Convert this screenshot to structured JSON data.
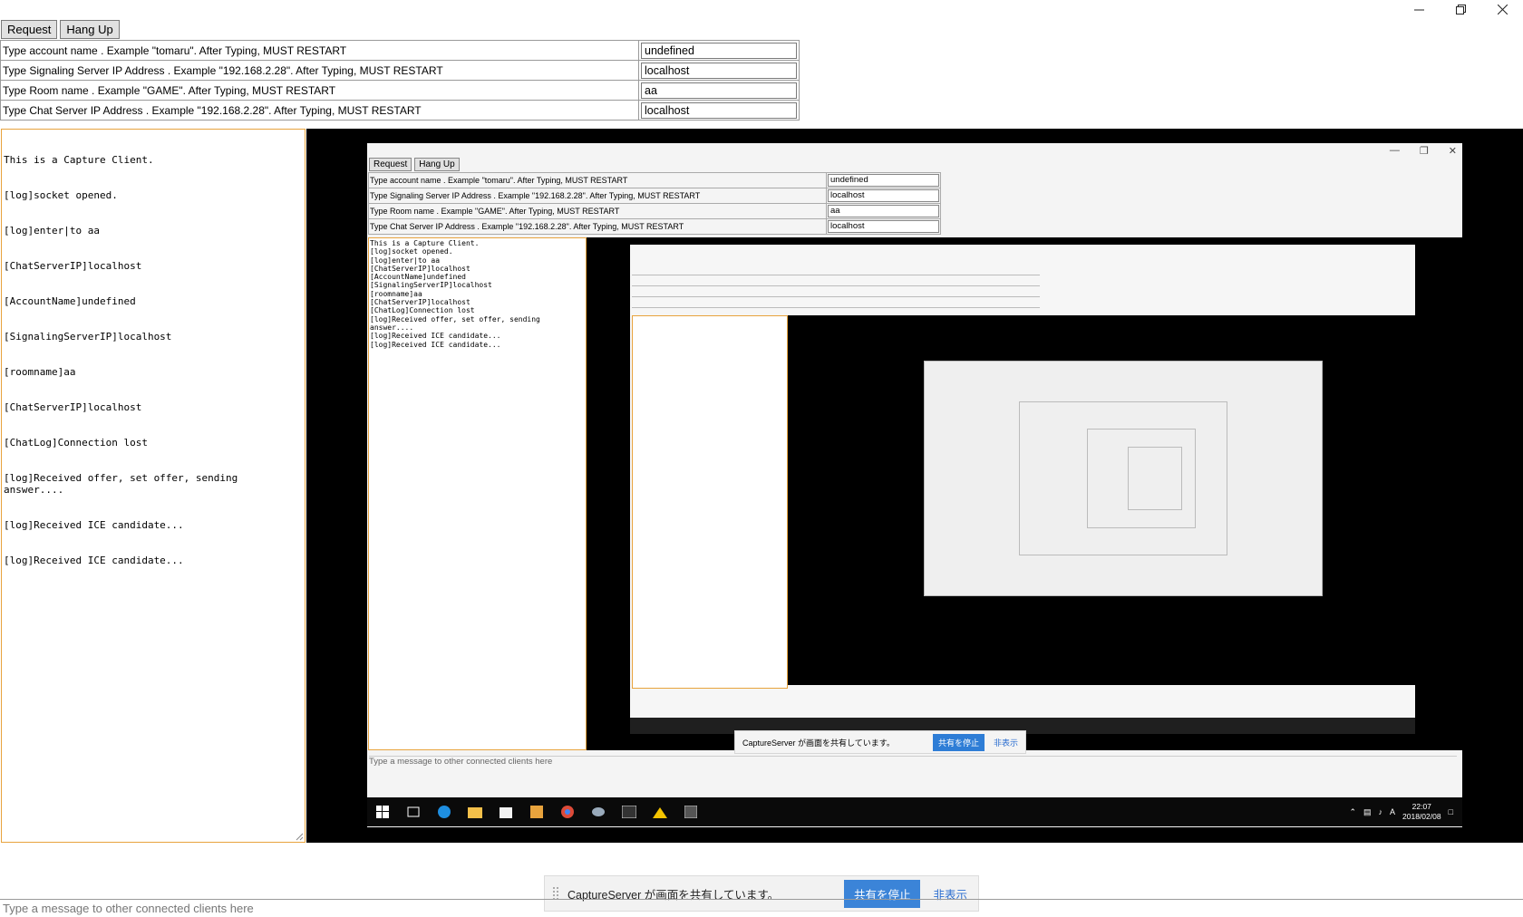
{
  "window_controls": {
    "minimize_icon": "minimize-icon",
    "restore_icon": "restore-icon",
    "close_icon": "close-icon"
  },
  "toolbar": {
    "request_label": "Request",
    "hangup_label": "Hang Up"
  },
  "settings": [
    {
      "label": "Type account name . Example \"tomaru\". After Typing, MUST RESTART",
      "value": "undefined"
    },
    {
      "label": "Type Signaling Server IP Address . Example \"192.168.2.28\". After Typing, MUST RESTART",
      "value": "localhost"
    },
    {
      "label": "Type Room name . Example \"GAME\". After Typing, MUST RESTART",
      "value": "aa"
    },
    {
      "label": "Type Chat Server IP Address . Example \"192.168.2.28\". After Typing, MUST RESTART",
      "value": "localhost"
    }
  ],
  "log_lines": [
    "This is a Capture Client.",
    "[log]socket opened.",
    "[log]enter|to aa",
    "[ChatServerIP]localhost",
    "[AccountName]undefined",
    "[SignalingServerIP]localhost",
    "[roomname]aa",
    "[ChatServerIP]localhost",
    "[ChatLog]Connection lost",
    "[log]Received offer, set offer, sending answer....",
    "[log]Received ICE candidate...",
    "[log]Received ICE candidate..."
  ],
  "share_bar": {
    "text": "CaptureServer が画面を共有しています。",
    "stop_label": "共有を停止",
    "hide_label": "非表示"
  },
  "chat": {
    "placeholder": "Type a message to other connected clients here"
  },
  "taskbar": {
    "time": "22:07",
    "date": "2018/02/08",
    "ime": "A"
  }
}
